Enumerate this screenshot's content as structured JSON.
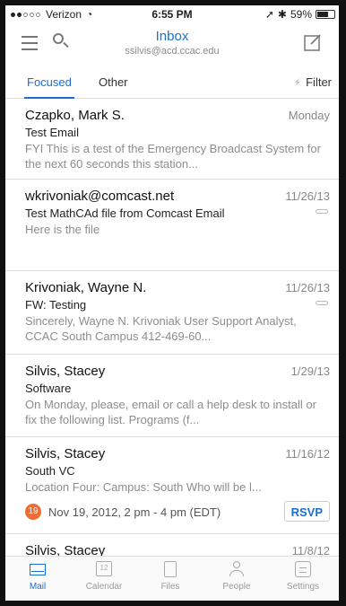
{
  "status_bar": {
    "carrier": "Verizon",
    "time": "6:55 PM",
    "battery": "59%"
  },
  "header": {
    "title": "Inbox",
    "account": "ssilvis@acd.ccac.edu"
  },
  "tabs": [
    {
      "label": "Focused"
    },
    {
      "label": "Other"
    }
  ],
  "filter": {
    "label": "Filter",
    "icon": "lightning-bolt-icon"
  },
  "messages": [
    {
      "sender": "Czapko, Mark S.",
      "date": "Monday",
      "subject": "Test Email",
      "preview": "FYI This is a test of the Emergency Broadcast System for the next 60 seconds this station..."
    },
    {
      "sender": "wkrivoniak@comcast.net",
      "date": "11/26/13",
      "subject": "Test MathCAd file from Comcast Email",
      "preview": "Here is the file",
      "attachment": true
    },
    {
      "sender": "Krivoniak, Wayne N.",
      "date": "11/26/13",
      "subject": "FW: Testing",
      "preview": "Sincerely, Wayne N. Krivoniak User Support Analyst, CCAC South Campus 412-469-60...",
      "attachment": true
    },
    {
      "sender": "Silvis, Stacey",
      "date": "1/29/13",
      "subject": "Software",
      "preview": "On Monday, please, email or call a help desk to install or fix the following list. Programs (f..."
    },
    {
      "sender": "Silvis, Stacey",
      "date": "11/16/12",
      "subject": "South VC",
      "preview": "Location Four: Campus: South Who will be l...",
      "event": {
        "text": "Nov 19, 2012, 2 pm - 4 pm (EDT)",
        "rsvp_label": "RSVP",
        "calendar_icon_text": "19"
      }
    },
    {
      "sender": "Silvis, Stacey",
      "date": "11/8/12"
    }
  ],
  "bottom_nav": [
    {
      "label": "Mail",
      "icon": "mail-icon",
      "active": true
    },
    {
      "label": "Calendar",
      "icon": "calendar-icon",
      "active": false,
      "icon_text": "12"
    },
    {
      "label": "Files",
      "icon": "files-icon",
      "active": false
    },
    {
      "label": "People",
      "icon": "people-icon",
      "active": false
    },
    {
      "label": "Settings",
      "icon": "settings-icon",
      "active": false
    }
  ],
  "colors": {
    "accent": "#1a6fd0",
    "calendar_event": "#ec6d38",
    "divider": "#dddddd",
    "secondary_text": "#8d8d8d"
  }
}
